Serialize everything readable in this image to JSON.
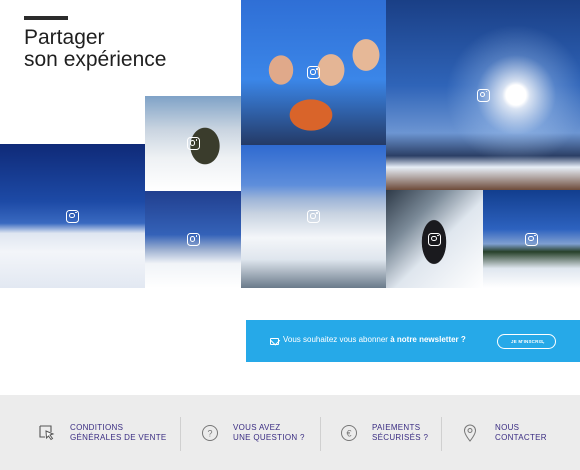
{
  "section": {
    "title_line1": "Partager",
    "title_line2": "son expérience"
  },
  "gallery": {
    "tiles": [
      {
        "name": "selfie-skiers",
        "icon": "instagram-icon"
      },
      {
        "name": "sun-over-chalet",
        "icon": "instagram-icon"
      },
      {
        "name": "skier-on-lift",
        "icon": "instagram-icon"
      },
      {
        "name": "snowy-slope-blue-sky",
        "icon": "instagram-icon"
      },
      {
        "name": "mountain-valley",
        "icon": "instagram-icon"
      },
      {
        "name": "snow-ridge",
        "icon": "instagram-icon"
      },
      {
        "name": "skier-close-up",
        "icon": "instagram-icon"
      },
      {
        "name": "pine-trees-slope",
        "icon": "instagram-icon"
      }
    ]
  },
  "newsletter": {
    "text_prefix": "Vous souhaitez vous abonner",
    "text_bold": "à notre newsletter ?",
    "button_label": "JE M'INSCRIS",
    "icon": "envelope-icon",
    "accent_color": "#26a9e8"
  },
  "footer": {
    "background": "#ececec",
    "text_color": "#3a2c82",
    "items": [
      {
        "line1": "CONDITIONS",
        "line2": "GÉNÉRALES DE VENTE",
        "icon": "cursor-click-icon"
      },
      {
        "line1": "VOUS AVEZ",
        "line2": "UNE QUESTION ?",
        "icon": "question-circle-icon"
      },
      {
        "line1": "PAIEMENTS",
        "line2": "SÉCURISÉS ?",
        "icon": "euro-circle-icon"
      },
      {
        "line1": "NOUS",
        "line2": "CONTACTER",
        "icon": "location-pin-icon"
      }
    ]
  }
}
